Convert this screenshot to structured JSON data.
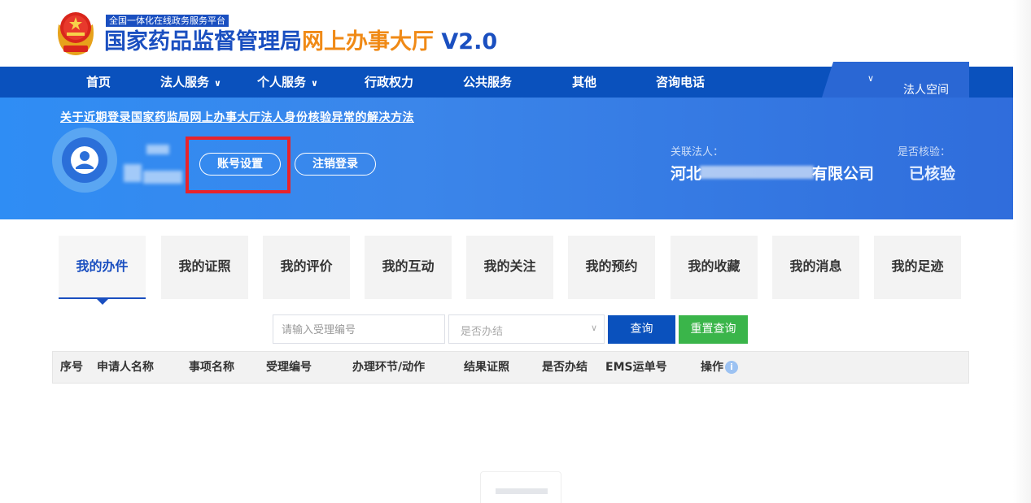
{
  "header": {
    "platform_tag": "全国一体化在线政务服务平台",
    "title_part1": "国家药品监督管理局",
    "title_part2": "网上办事大厅",
    "title_part3": " V2.0"
  },
  "nav": {
    "items": [
      {
        "label": "首页"
      },
      {
        "label": "法人服务"
      },
      {
        "label": "个人服务"
      },
      {
        "label": "行政权力"
      },
      {
        "label": "公共服务"
      },
      {
        "label": "其他"
      },
      {
        "label": "咨询电话"
      }
    ],
    "right_label": "法人空间",
    "chevron": "∨"
  },
  "banner": {
    "notice": "关于近期登录国家药监局网上办事大厅法人身份核验异常的解决方法",
    "account_button": "账号设置",
    "logout_button": "注销登录",
    "related_label": "关联法人：",
    "company_prefix": "河北",
    "company_suffix": "有限公司",
    "verify_label": "是否核验：",
    "verify_value": "已核验"
  },
  "tabs": [
    {
      "label": "我的办件",
      "active": true
    },
    {
      "label": "我的证照"
    },
    {
      "label": "我的评价"
    },
    {
      "label": "我的互动"
    },
    {
      "label": "我的关注"
    },
    {
      "label": "我的预约"
    },
    {
      "label": "我的收藏"
    },
    {
      "label": "我的消息"
    },
    {
      "label": "我的足迹"
    }
  ],
  "search": {
    "placeholder": "请输入受理编号",
    "select_placeholder": "是否办结",
    "query_button": "查询",
    "reset_button": "重置查询"
  },
  "table": {
    "headers": [
      "序号",
      "申请人名称",
      "事项名称",
      "受理编号",
      "办理环节/动作",
      "结果证照",
      "是否办结",
      "EMS运单号",
      "操作"
    ],
    "info_icon": "i"
  },
  "colors": {
    "primary": "#0a51bd",
    "accent_orange": "#f08a16",
    "reset_green": "#3ab54a",
    "highlight_red": "#e8232b"
  }
}
